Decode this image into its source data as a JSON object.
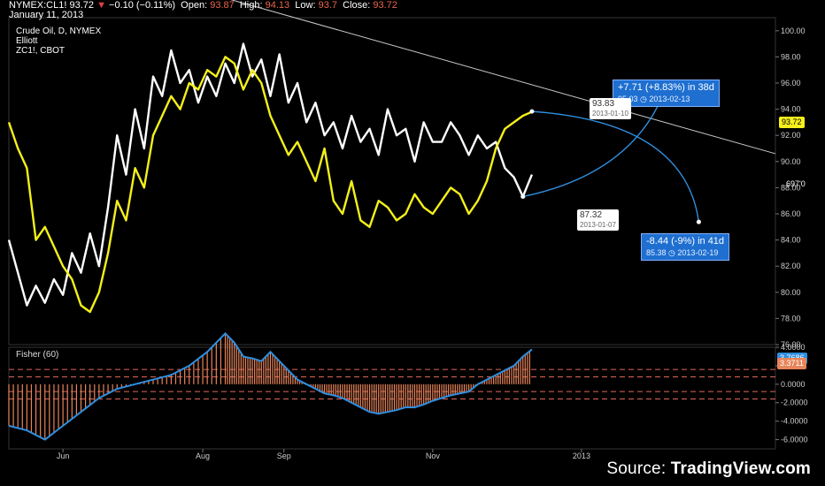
{
  "header": {
    "symbol": "NYMEX:CL1!",
    "last": "93.72",
    "change": "−0.10 (−0.11%)",
    "open_label": "Open:",
    "open": "93.87",
    "high_label": "High:",
    "high": "94.13",
    "low_label": "Low:",
    "low": "93.7",
    "close_label": "Close:",
    "close": "93.72",
    "date": "January 11, 2013"
  },
  "legend": {
    "main": "Crude Oil, D, NYMEX",
    "study": "Elliott",
    "compare": "ZC1!, CBOT"
  },
  "annotations": {
    "up": {
      "text": "+7.71 (+8.83%) in 38d",
      "sub": "95.03 ◷ 2013-02-13"
    },
    "down": {
      "text": "-8.44 (-9%) in 41d",
      "sub": "85.38 ◷ 2013-02-19"
    },
    "hi_tag": {
      "value": "93.83",
      "date": "2013-01-10"
    },
    "lo_tag": {
      "value": "87.32",
      "date": "2013-01-07"
    },
    "last_badge": "93.72",
    "compare_badge": "697'0",
    "fisher_badge_a": "3.7686",
    "fisher_badge_b": "3.3711"
  },
  "source": {
    "prefix": "Source: ",
    "brand": "TradingView.com"
  },
  "colors": {
    "crude": "#ffffff",
    "corn": "#f5f01a",
    "fisher": "#2f8fe0",
    "hist": "#e8845a",
    "trend": "#cccccc",
    "dashed": "#e06a5a",
    "annotation": "#1e6fd0"
  },
  "chart_data": [
    {
      "type": "line",
      "title": "Crude Oil, D, NYMEX",
      "ylim": [
        76,
        101
      ],
      "yticks": [
        "100.00",
        "98.00",
        "96.00",
        "94.00",
        "92.00",
        "90.00",
        "88.00",
        "86.00",
        "84.00",
        "82.00",
        "80.00",
        "78.00",
        "76.00"
      ],
      "xticks": [
        "Jun",
        "Aug",
        "Sep",
        "Nov",
        "2013"
      ],
      "series": [
        {
          "name": "Crude Oil, D, NYMEX",
          "x": [
            0,
            4,
            8,
            12,
            16,
            20,
            24,
            28,
            32,
            36,
            40,
            44,
            48,
            52,
            56,
            60,
            64,
            68,
            72,
            76,
            80,
            84,
            88,
            92,
            96,
            100,
            104,
            108,
            112,
            116,
            120,
            124,
            128,
            132,
            136,
            140,
            144,
            148,
            152,
            156,
            160,
            164,
            168,
            172,
            176,
            180,
            184,
            188,
            192,
            196,
            200,
            204,
            208,
            212,
            216,
            220,
            224,
            228,
            232
          ],
          "y": [
            84.0,
            81.5,
            79.0,
            80.5,
            79.2,
            81.0,
            79.8,
            83.0,
            81.5,
            84.5,
            82.0,
            86.5,
            92.0,
            89.0,
            94.0,
            91.0,
            96.5,
            95.0,
            98.5,
            96.0,
            97.0,
            94.5,
            96.5,
            95.0,
            97.5,
            96.0,
            99.0,
            96.5,
            97.8,
            95.0,
            98.2,
            94.5,
            96.0,
            93.0,
            94.5,
            92.0,
            93.0,
            91.0,
            93.5,
            91.5,
            92.5,
            90.5,
            94.0,
            92.0,
            92.5,
            90.0,
            93.0,
            91.5,
            91.5,
            93.0,
            92.0,
            90.5,
            92.0,
            91.0,
            91.5,
            89.5,
            88.8,
            87.32,
            89.0
          ]
        },
        {
          "name": "ZC1!, CBOT",
          "x": [
            0,
            4,
            8,
            12,
            16,
            20,
            24,
            28,
            32,
            36,
            40,
            44,
            48,
            52,
            56,
            60,
            64,
            68,
            72,
            76,
            80,
            84,
            88,
            92,
            96,
            100,
            104,
            108,
            112,
            116,
            120,
            124,
            128,
            132,
            136,
            140,
            144,
            148,
            152,
            156,
            160,
            164,
            168,
            172,
            176,
            180,
            184,
            188,
            192,
            196,
            200,
            204,
            208,
            212,
            216,
            220,
            224,
            228,
            232
          ],
          "y": [
            93.0,
            91.0,
            89.5,
            84.0,
            85.0,
            83.5,
            82.0,
            81.0,
            79.0,
            78.5,
            80.0,
            83.0,
            87.0,
            85.5,
            89.5,
            88.0,
            92.0,
            93.5,
            95.0,
            94.0,
            96.0,
            95.5,
            97.0,
            96.5,
            98.0,
            97.5,
            95.5,
            97.0,
            96.0,
            93.5,
            92.0,
            90.5,
            91.5,
            90.0,
            88.5,
            91.0,
            87.0,
            86.0,
            88.5,
            85.5,
            85.0,
            87.0,
            86.5,
            85.5,
            86.0,
            87.5,
            86.5,
            86.0,
            87.0,
            88.0,
            87.5,
            86.0,
            87.0,
            88.5,
            91.0,
            92.5,
            93.0,
            93.5,
            93.8
          ]
        }
      ]
    },
    {
      "type": "line",
      "title": "Fisher (60)",
      "ylim": [
        -7,
        4
      ],
      "yticks": [
        "4.0000",
        "2.0000",
        "0.0000",
        "-2.0000",
        "-4.0000",
        "-6.0000"
      ],
      "series": [
        {
          "name": "Fisher (60)",
          "x": [
            0,
            8,
            16,
            24,
            32,
            40,
            48,
            56,
            64,
            72,
            80,
            88,
            96,
            100,
            104,
            108,
            112,
            116,
            120,
            124,
            128,
            132,
            136,
            140,
            144,
            148,
            152,
            156,
            160,
            164,
            168,
            172,
            176,
            180,
            184,
            188,
            192,
            196,
            200,
            204,
            208,
            212,
            216,
            220,
            224,
            228,
            232
          ],
          "y": [
            -4.5,
            -5.0,
            -6.0,
            -4.5,
            -3.0,
            -1.5,
            -0.5,
            0.0,
            0.5,
            1.0,
            2.0,
            3.5,
            5.5,
            4.5,
            3.0,
            2.8,
            2.5,
            3.5,
            2.5,
            1.5,
            0.5,
            0.0,
            -0.5,
            -1.0,
            -1.2,
            -1.5,
            -2.0,
            -2.5,
            -3.0,
            -3.2,
            -3.0,
            -2.8,
            -2.5,
            -2.5,
            -2.2,
            -1.8,
            -1.5,
            -1.2,
            -1.0,
            -0.8,
            0.0,
            0.5,
            1.0,
            1.5,
            2.0,
            3.0,
            3.77
          ]
        }
      ]
    }
  ]
}
